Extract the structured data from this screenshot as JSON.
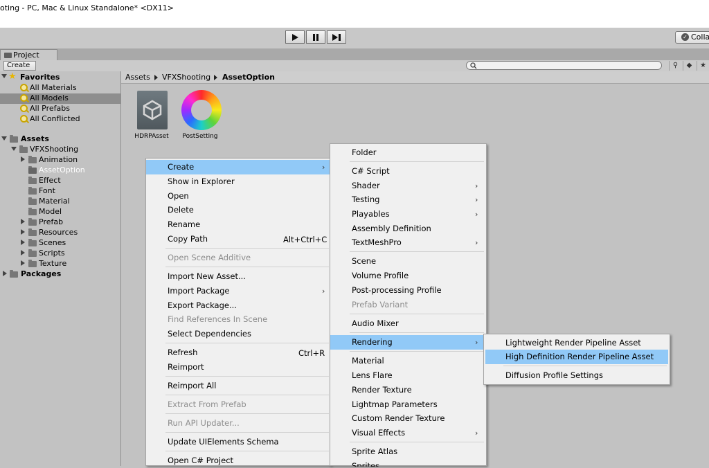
{
  "window": {
    "title": "oting - PC, Mac & Linux Standalone* <DX11>"
  },
  "toolbar": {
    "collab_label": "Colla"
  },
  "project_tab": {
    "label": "Project"
  },
  "project_toolbar": {
    "create_label": "Create",
    "search_placeholder": ""
  },
  "tree": {
    "favorites": {
      "label": "Favorites",
      "items": [
        "All Materials",
        "All Models",
        "All Prefabs",
        "All Conflicted"
      ]
    },
    "assets": {
      "label": "Assets",
      "vfx": "VFXShooting",
      "children": [
        "Animation",
        "AssetOption",
        "Effect",
        "Font",
        "Material",
        "Model",
        "Prefab",
        "Resources",
        "Scenes",
        "Scripts",
        "Texture"
      ]
    },
    "packages": {
      "label": "Packages"
    }
  },
  "breadcrumb": [
    "Assets",
    "VFXShooting",
    "AssetOption"
  ],
  "grid_assets": [
    {
      "label": "HDRPAsset",
      "icon": "unity-logo-icon"
    },
    {
      "label": "PostSetting",
      "icon": "color-wheel-icon"
    }
  ],
  "context_menu": {
    "create": "Create",
    "show_in_explorer": "Show in Explorer",
    "open": "Open",
    "delete": "Delete",
    "rename": "Rename",
    "copy_path": "Copy Path",
    "copy_path_shortcut": "Alt+Ctrl+C",
    "open_scene_additive": "Open Scene Additive",
    "import_new_asset": "Import New Asset...",
    "import_package": "Import Package",
    "export_package": "Export Package...",
    "find_references": "Find References In Scene",
    "select_dependencies": "Select Dependencies",
    "refresh": "Refresh",
    "refresh_shortcut": "Ctrl+R",
    "reimport": "Reimport",
    "reimport_all": "Reimport All",
    "extract_from_prefab": "Extract From Prefab",
    "run_api_updater": "Run API Updater...",
    "update_ui_elements": "Update UIElements Schema",
    "open_cs_project": "Open C# Project"
  },
  "create_menu": {
    "folder": "Folder",
    "cs_script": "C# Script",
    "shader": "Shader",
    "testing": "Testing",
    "playables": "Playables",
    "assembly_definition": "Assembly Definition",
    "textmeshpro": "TextMeshPro",
    "scene": "Scene",
    "volume_profile": "Volume Profile",
    "post_processing_profile": "Post-processing Profile",
    "prefab_variant": "Prefab Variant",
    "audio_mixer": "Audio Mixer",
    "rendering": "Rendering",
    "material": "Material",
    "lens_flare": "Lens Flare",
    "render_texture": "Render Texture",
    "lightmap_parameters": "Lightmap Parameters",
    "custom_render_texture": "Custom Render Texture",
    "visual_effects": "Visual Effects",
    "sprite_atlas": "Sprite Atlas",
    "sprites": "Sprites"
  },
  "rendering_menu": {
    "lightweight": "Lightweight Render Pipeline Asset",
    "high_definition": "High Definition Render Pipeline Asset",
    "diffusion": "Diffusion Profile Settings"
  },
  "colors": {
    "highlight": "#91c9f7",
    "selected_row": "#8e8e8e",
    "menu_bg": "#f0f0f0"
  }
}
